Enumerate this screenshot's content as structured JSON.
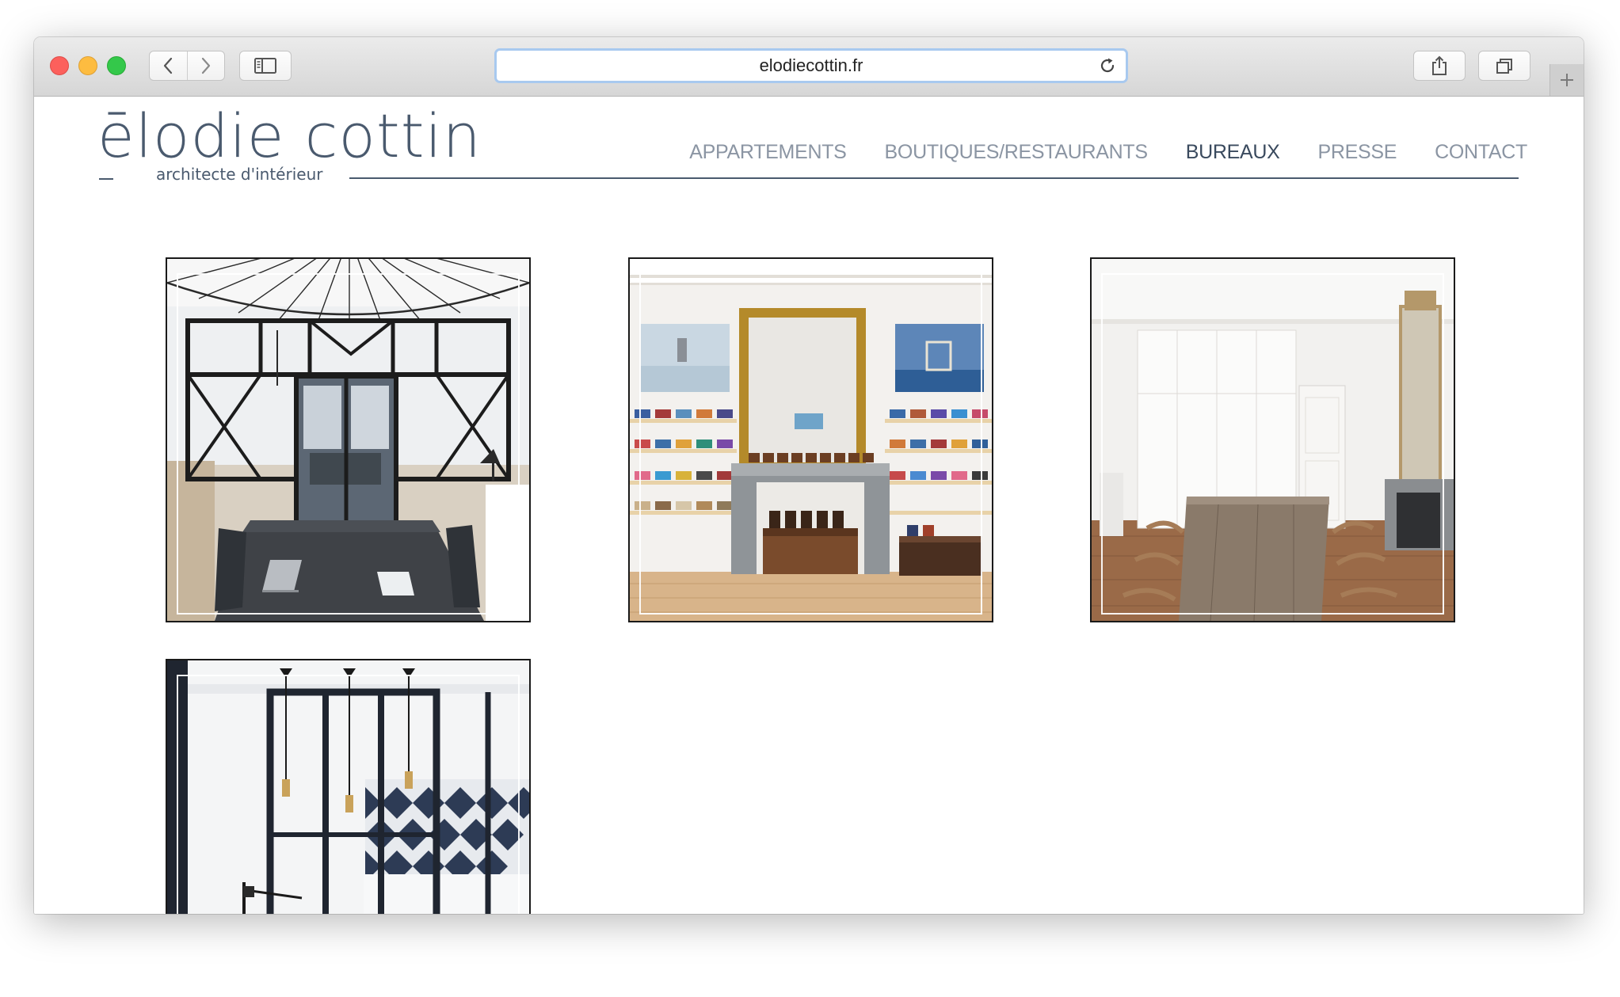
{
  "browser": {
    "url": "elodiecottin.fr",
    "controls": {
      "back_icon": "chevron-left-icon",
      "forward_icon": "chevron-right-icon",
      "sidebar_icon": "sidebar-icon",
      "reload_icon": "reload-icon",
      "share_icon": "share-icon",
      "tabs_icon": "tabs-overview-icon",
      "new_tab_icon": "plus-icon"
    }
  },
  "site": {
    "logo": {
      "name": "ēlodie cottin",
      "tagline": "architecte d'intérieur"
    },
    "nav": [
      {
        "label": "APPARTEMENTS",
        "active": false
      },
      {
        "label": "BOUTIQUES/RESTAURANTS",
        "active": false
      },
      {
        "label": "BUREAUX",
        "active": true
      },
      {
        "label": "PRESSE",
        "active": false
      },
      {
        "label": "CONTACT",
        "active": false
      }
    ],
    "gallery": [
      {
        "subject": "office with black glass partition and desk"
      },
      {
        "subject": "shoe boutique with marble fireplace and gilded mirror"
      },
      {
        "subject": "meeting room with long wooden table"
      },
      {
        "subject": "office with black steel glass wall and pendant lights"
      }
    ]
  },
  "colors": {
    "brand_text": "#4a5a6e",
    "nav_inactive": "#8b95a3",
    "nav_active": "#3a4a5e",
    "address_focus": "#a8c9ef"
  }
}
